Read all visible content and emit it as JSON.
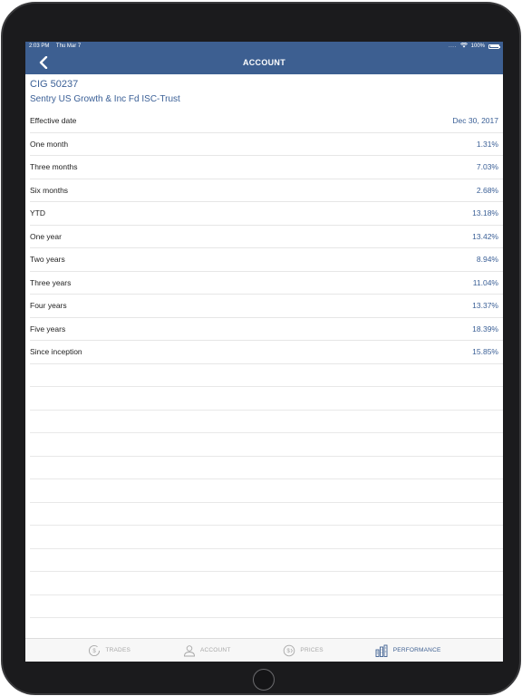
{
  "status_bar": {
    "time": "2:03 PM",
    "date": "Thu Mar 7",
    "signal_dots": "....",
    "battery": "100%"
  },
  "nav": {
    "title": "ACCOUNT"
  },
  "fund": {
    "code": "CIG 50237",
    "name": "Sentry US Growth & Inc Fd ISC-Trust"
  },
  "performance": {
    "rows": [
      {
        "label": "Effective date",
        "value": "Dec 30, 2017"
      },
      {
        "label": "One month",
        "value": "1.31%"
      },
      {
        "label": "Three months",
        "value": "7.03%"
      },
      {
        "label": "Six months",
        "value": "2.68%"
      },
      {
        "label": "YTD",
        "value": "13.18%"
      },
      {
        "label": "One year",
        "value": "13.42%"
      },
      {
        "label": "Two years",
        "value": "8.94%"
      },
      {
        "label": "Three years",
        "value": "11.04%"
      },
      {
        "label": "Four years",
        "value": "13.37%"
      },
      {
        "label": "Five years",
        "value": "18.39%"
      },
      {
        "label": "Since inception",
        "value": "15.85%"
      }
    ]
  },
  "tabs": [
    {
      "label": "TRADES",
      "icon": "dollar-circle-icon",
      "active": false
    },
    {
      "label": "ACCOUNT",
      "icon": "person-icon",
      "active": false
    },
    {
      "label": "PRICES",
      "icon": "price-tag-icon",
      "active": false
    },
    {
      "label": "PERFORMANCE",
      "icon": "bar-chart-icon",
      "active": true
    }
  ],
  "colors": {
    "primary": "#3d5f91",
    "accent_text": "#3a5f96",
    "inactive_tab": "#a8a8a8"
  }
}
